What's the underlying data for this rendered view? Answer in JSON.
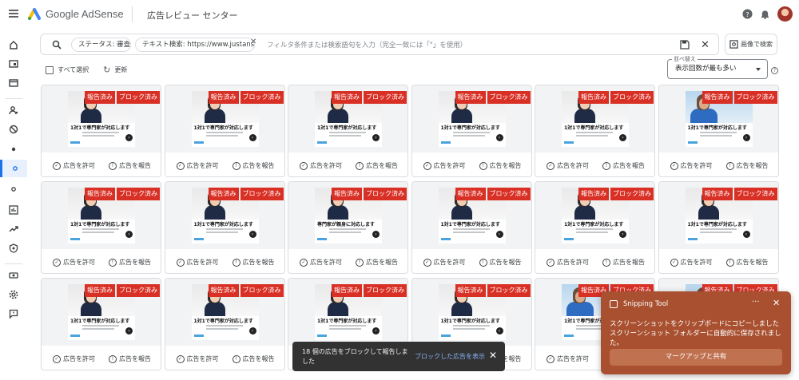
{
  "app": {
    "brand": "Google AdSense",
    "page_title": "広告レビュー センター"
  },
  "topbar_icons": [
    "help-icon",
    "notifications-icon",
    "avatar"
  ],
  "nav_icons": [
    "home-icon",
    "sites-icon",
    "ads-icon",
    "account-icon",
    "block-icon",
    "dot-icon",
    "dot-active-icon",
    "dot-outline-icon",
    "reports-icon",
    "trending-icon",
    "policy-icon",
    "payments-icon",
    "settings-icon",
    "feedback-icon"
  ],
  "filter": {
    "chip1": "ステータス: 審査前",
    "chip2": "テキスト検索: https://www.justanswer.j...",
    "placeholder": "フィルタ条件または検索語句を入力（完全一致には「\"」を使用）",
    "image_search": "画像で検索"
  },
  "toolbar": {
    "select_all": "すべて選択",
    "refresh": "更新"
  },
  "sort": {
    "label": "並べ替え",
    "value": "表示回数が最も多い"
  },
  "card_labels": {
    "report_badge": "報告済み",
    "block_badge": "ブロック済み",
    "allow": "広告を許可",
    "report": "広告を報告"
  },
  "cards": [
    {
      "ad_title": "1対1で専門家が対応します",
      "variant": "woman"
    },
    {
      "ad_title": "1対1で専門家が対応します",
      "variant": "woman"
    },
    {
      "ad_title": "1対1で専門家が対応します",
      "variant": "woman"
    },
    {
      "ad_title": "1対1で専門家が対応します",
      "variant": "woman"
    },
    {
      "ad_title": "1対1で専門家が対応します",
      "variant": "woman"
    },
    {
      "ad_title": "1対1で専門家が対応します",
      "variant": "man"
    },
    {
      "ad_title": "1対1で専門家が対応します",
      "variant": "woman"
    },
    {
      "ad_title": "1対1で専門家が対応します",
      "variant": "woman"
    },
    {
      "ad_title": "専門家が親身に対応します",
      "variant": "woman"
    },
    {
      "ad_title": "1対1で専門家が対応します",
      "variant": "woman"
    },
    {
      "ad_title": "1対1で専門家が対応します",
      "variant": "woman"
    },
    {
      "ad_title": "1対1で専門家が対応します",
      "variant": "woman"
    },
    {
      "ad_title": "1対1で専門家が対応します",
      "variant": "woman"
    },
    {
      "ad_title": "1対1で専門家が対応します",
      "variant": "woman"
    },
    {
      "ad_title": "1対1で専門家が対応します",
      "variant": "woman"
    },
    {
      "ad_title": "1対1で専門家が対応します",
      "variant": "woman"
    },
    {
      "ad_title": "1対1で専門家が対応します",
      "variant": "man"
    },
    {
      "ad_title": "1対1で専門家が対応します",
      "variant": "man"
    }
  ],
  "snackbar": {
    "message": "18 個の広告をブロックして報告しました",
    "action": "ブロックした広告を表示"
  },
  "toast": {
    "app": "Snipping Tool",
    "line1": "スクリーンショットをクリップボードにコピーしました",
    "line2": "スクリーンショット フォルダーに自動的に保存されました。",
    "button": "マークアップと共有"
  }
}
